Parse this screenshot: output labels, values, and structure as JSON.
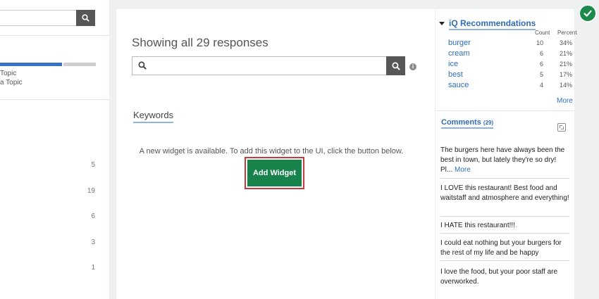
{
  "left_panel": {
    "topic_lines": [
      "Topic",
      "a Topic"
    ],
    "counts": [
      "5",
      "19",
      "6",
      "3",
      "1"
    ]
  },
  "main": {
    "showing_text": "Showing all 29 responses",
    "search_placeholder": "",
    "info_glyph": "i",
    "keywords_heading": "Keywords",
    "widget_message": "A new widget is available. To add this widget to the UI, click the button below.",
    "add_widget_label": "Add Widget"
  },
  "recommendations": {
    "title": "iQ Recommendations",
    "count_header": "Count",
    "percent_header": "Percent",
    "rows": [
      {
        "word": "burger",
        "count": "10",
        "percent": "34%"
      },
      {
        "word": "cream",
        "count": "6",
        "percent": "21%"
      },
      {
        "word": "ice",
        "count": "6",
        "percent": "21%"
      },
      {
        "word": "best",
        "count": "5",
        "percent": "17%"
      },
      {
        "word": "sauce",
        "count": "4",
        "percent": "14%"
      }
    ],
    "more_label": "More"
  },
  "comments": {
    "title": "Comments",
    "count": "(29)",
    "items": [
      {
        "text": "The burgers here have always been the best in town, but lately they're so dry! Pl...",
        "more": "More"
      },
      {
        "text": "I LOVE this restaurant! Best food and waitstaff and atmosphere and everything!"
      },
      {
        "text": "I HATE this restaurant!!!"
      },
      {
        "text": "I could eat nothing but your burgers for the rest of my life and be happy"
      },
      {
        "text": "I love the food, but your poor staff are overworked."
      }
    ]
  },
  "colors": {
    "accent_blue": "#2f6db7",
    "button_green": "#17824a",
    "highlight_red": "#c43b3f",
    "search_button": "#565656"
  },
  "icons": [
    "search-icon",
    "info-icon",
    "expand-icon",
    "checkmark-icon",
    "dropdown-arrow-icon"
  ]
}
